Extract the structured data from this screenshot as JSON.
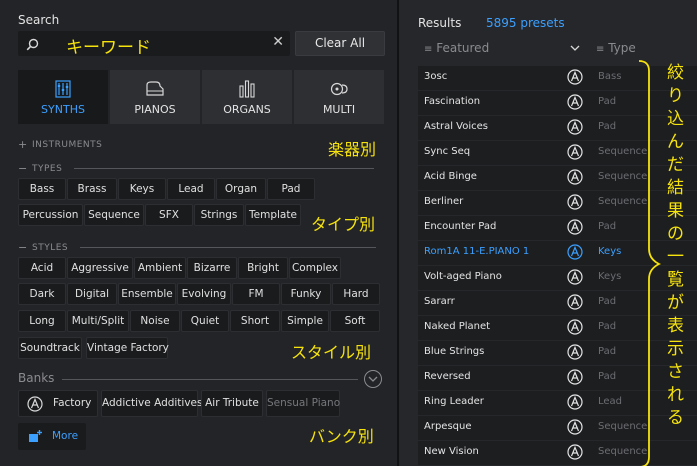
{
  "search": {
    "title": "Search",
    "annotation": "キーワード",
    "clear_label": "Clear All"
  },
  "tabs": [
    {
      "label": "SYNTHS",
      "icon": "synth-icon",
      "active": true
    },
    {
      "label": "PIANOS",
      "icon": "piano-icon",
      "active": false
    },
    {
      "label": "ORGANS",
      "icon": "organ-icon",
      "active": false
    },
    {
      "label": "MULTI",
      "icon": "multi-icon",
      "active": false
    }
  ],
  "instruments": {
    "label": "INSTRUMENTS",
    "annotation": "楽器別"
  },
  "types": {
    "label": "TYPES",
    "annotation": "タイプ別",
    "tags": [
      "Bass",
      "Brass",
      "Keys",
      "Lead",
      "Organ",
      "Pad",
      "Percussion",
      "Sequence",
      "SFX",
      "Strings",
      "Template"
    ]
  },
  "styles": {
    "label": "STYLES",
    "annotation": "スタイル別",
    "tags": [
      "Acid",
      "Aggressive",
      "Ambient",
      "Bizarre",
      "Bright",
      "Complex",
      "Dark",
      "Digital",
      "Ensemble",
      "Evolving",
      "FM",
      "Funky",
      "Hard",
      "Long",
      "Multi/Split",
      "Noise",
      "Quiet",
      "Short",
      "Simple",
      "Soft",
      "Soundtrack",
      "Vintage Factory"
    ]
  },
  "banks": {
    "title": "Banks",
    "annotation": "バンク別",
    "items": [
      "Factory",
      "Addictive Additives",
      "Air Tribute",
      "Sensual Piano"
    ],
    "more_label": "More"
  },
  "results": {
    "title": "Results",
    "count": "5895 presets",
    "col_featured": "Featured",
    "col_type": "Type",
    "annotation": "絞り込んだ結果の一覧が表示される",
    "rows": [
      {
        "name": "3osc",
        "type": "Bass"
      },
      {
        "name": "Fascination",
        "type": "Pad"
      },
      {
        "name": "Astral Voices",
        "type": "Pad"
      },
      {
        "name": "Sync Seq",
        "type": "Sequence"
      },
      {
        "name": "Acid Binge",
        "type": "Sequence"
      },
      {
        "name": "Berliner",
        "type": "Sequence"
      },
      {
        "name": "Encounter Pad",
        "type": "Pad"
      },
      {
        "name": "Rom1A 11-E.PIANO 1",
        "type": "Keys",
        "selected": true
      },
      {
        "name": "Volt-aged Piano",
        "type": "Keys"
      },
      {
        "name": "Sararr",
        "type": "Pad"
      },
      {
        "name": "Naked Planet",
        "type": "Pad"
      },
      {
        "name": "Blue Strings",
        "type": "Pad"
      },
      {
        "name": "Reversed",
        "type": "Pad"
      },
      {
        "name": "Ring Leader",
        "type": "Lead"
      },
      {
        "name": "Arpesque",
        "type": "Sequence"
      },
      {
        "name": "New Vision",
        "type": "Sequence"
      }
    ]
  },
  "colors": {
    "accent": "#3ba0ff",
    "annotation": "#f6e30d"
  }
}
